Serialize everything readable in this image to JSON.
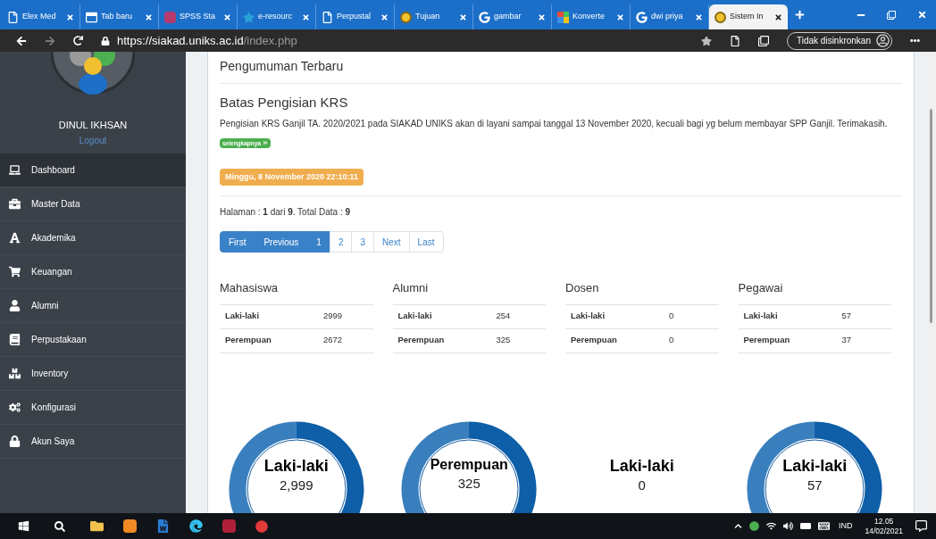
{
  "browser": {
    "tabs": [
      {
        "title": "Elex Med",
        "kind": "page",
        "selected": false
      },
      {
        "title": "Tab baru",
        "kind": "newtab",
        "selected": false
      },
      {
        "title": "SPSS Sta",
        "kind": "spss",
        "selected": false
      },
      {
        "title": "e-resourc",
        "kind": "star",
        "selected": false
      },
      {
        "title": "Perpustal",
        "kind": "page",
        "selected": false
      },
      {
        "title": "Tujuan",
        "kind": "logo",
        "selected": false
      },
      {
        "title": "gambar",
        "kind": "google",
        "selected": false
      },
      {
        "title": "Konverte",
        "kind": "grid",
        "selected": false
      },
      {
        "title": "dwi priya",
        "kind": "google",
        "selected": false
      },
      {
        "title": "Sistem In",
        "kind": "logo",
        "selected": true
      }
    ],
    "address": {
      "host": "https://siakad.uniks.ac.id",
      "path": "/index.php"
    },
    "sync_button": "Tidak disinkronkan"
  },
  "sidebar": {
    "user_name": "DINUL IKHSAN",
    "logout": "Logout",
    "items": [
      {
        "label": "Dashboard",
        "kind": "laptop",
        "selected": true
      },
      {
        "label": "Master Data",
        "kind": "briefcase",
        "selected": false
      },
      {
        "label": "Akademika",
        "kind": "font",
        "selected": false
      },
      {
        "label": "Keuangan",
        "kind": "cart",
        "selected": false
      },
      {
        "label": "Alumni",
        "kind": "user",
        "selected": false
      },
      {
        "label": "Perpustakaan",
        "kind": "book",
        "selected": false
      },
      {
        "label": "Inventory",
        "kind": "inventory",
        "selected": false
      },
      {
        "label": "Konfigurasi",
        "kind": "cogs",
        "selected": false
      },
      {
        "label": "Akun Saya",
        "kind": "lock",
        "selected": false
      }
    ]
  },
  "announcements": {
    "title": "Pengumuman Terbaru",
    "item": {
      "heading": "Batas Pengisian KRS",
      "body": "Pengisian KRS Ganjil TA. 2020/2021 pada SIAKAD UNIKS akan di layani sampai tanggal 13 November 2020, kecuali bagi yg belum membayar SPP Ganjil. Terimakasih.",
      "more_link": "selengkapnya",
      "date": "Minggu, 8 November 2020 22:10:11"
    },
    "page_info": "Halaman : **1** dari **9**. Total Data : **9**",
    "pagination": [
      {
        "label": "First",
        "selected": true
      },
      {
        "label": "Previous",
        "selected": true
      },
      {
        "label": "1",
        "selected": true
      },
      {
        "label": "2",
        "selected": false
      },
      {
        "label": "3",
        "selected": false
      },
      {
        "label": "Next",
        "selected": false
      },
      {
        "label": "Last",
        "selected": false
      }
    ]
  },
  "stats": [
    {
      "title": "Mahasiswa",
      "rows": [
        {
          "label": "Laki-laki",
          "value": "2999"
        },
        {
          "label": "Perempuan",
          "value": "2672"
        }
      ],
      "donut": {
        "label": "Laki-laki",
        "value": "2,999"
      }
    },
    {
      "title": "Alumni",
      "rows": [
        {
          "label": "Laki-laki",
          "value": "254"
        },
        {
          "label": "Perempuan",
          "value": "325"
        }
      ],
      "donut": {
        "label": "Perempuan",
        "value": "325"
      }
    },
    {
      "title": "Dosen",
      "rows": [
        {
          "label": "Laki-laki",
          "value": "0"
        },
        {
          "label": "Perempuan",
          "value": "0"
        }
      ],
      "donut": {
        "label": "Laki-laki",
        "value": "0"
      }
    },
    {
      "title": "Pegawai",
      "rows": [
        {
          "label": "Laki-laki",
          "value": "57"
        },
        {
          "label": "Perempuan",
          "value": "37"
        }
      ],
      "donut": {
        "label": "Laki-laki",
        "value": "57"
      }
    }
  ],
  "taskbar": {
    "language": "IND",
    "time": "12.05",
    "date": "14/02/2021"
  }
}
